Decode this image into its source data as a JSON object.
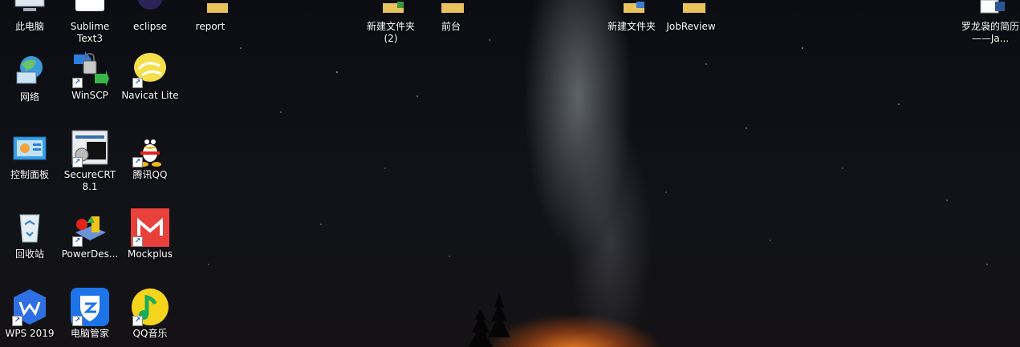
{
  "desktop": {
    "icons": [
      {
        "label": "此电脑",
        "icon": "computer-icon"
      },
      {
        "label": "Sublime Text3",
        "icon": "sublime-icon"
      },
      {
        "label": "eclipse",
        "icon": "eclipse-icon"
      },
      {
        "label": "report",
        "icon": "folder-icon"
      },
      {
        "label": "新建文件夹 (2)",
        "icon": "folder-icon"
      },
      {
        "label": "前台",
        "icon": "folder-icon"
      },
      {
        "label": "新建文件夹",
        "icon": "folder-icon"
      },
      {
        "label": "JobReview",
        "icon": "folder-icon"
      },
      {
        "label": "罗龙袅的简历——Ja...",
        "icon": "word-document-icon"
      },
      {
        "label": "网络",
        "icon": "network-icon"
      },
      {
        "label": "WinSCP",
        "icon": "winscp-icon"
      },
      {
        "label": "Navicat Lite",
        "icon": "navicat-icon"
      },
      {
        "label": "控制面板",
        "icon": "control-panel-icon"
      },
      {
        "label": "SecureCRT 8.1",
        "icon": "securecrt-icon"
      },
      {
        "label": "腾讯QQ",
        "icon": "qq-icon"
      },
      {
        "label": "回收站",
        "icon": "recycle-bin-icon"
      },
      {
        "label": "PowerDes...",
        "icon": "powerdesigner-icon"
      },
      {
        "label": "Mockplus",
        "icon": "mockplus-icon"
      },
      {
        "label": "WPS 2019",
        "icon": "wps-icon"
      },
      {
        "label": "电脑管家",
        "icon": "pc-manager-icon"
      },
      {
        "label": "QQ音乐",
        "icon": "qq-music-icon"
      }
    ]
  }
}
